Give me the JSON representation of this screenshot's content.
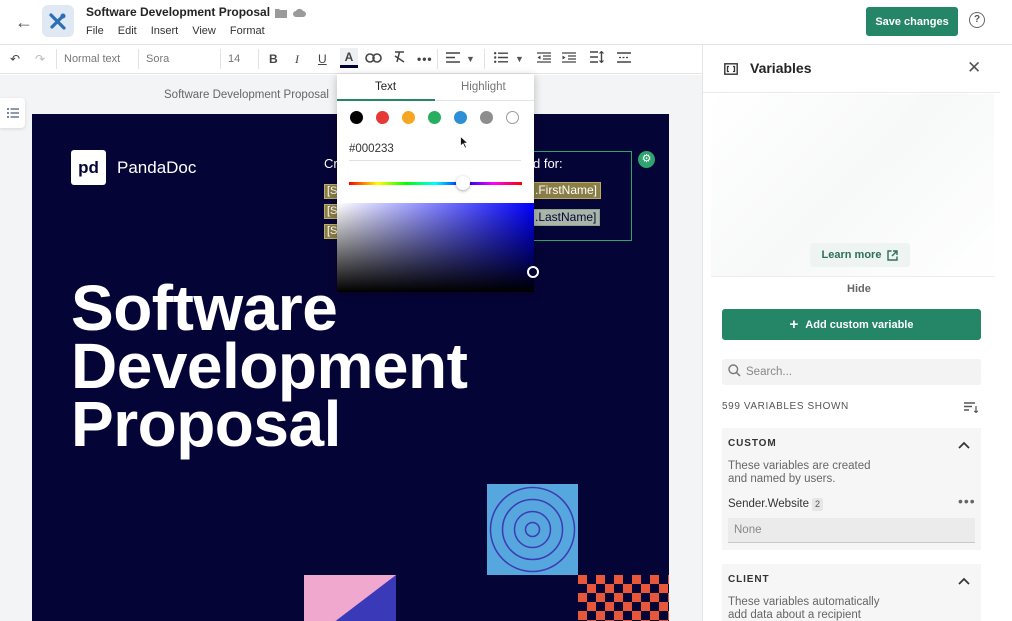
{
  "header": {
    "title": "Software Development Proposal",
    "menu": [
      "File",
      "Edit",
      "Insert",
      "View",
      "Format"
    ],
    "save_label": "Save changes",
    "help_glyph": "?"
  },
  "toolbar": {
    "style": "Normal text",
    "font": "Sora",
    "size": "14"
  },
  "document": {
    "page_label": "Software Development Proposal",
    "brand": "PandaDoc",
    "created_prefix": "Cr",
    "chip_fragment": "[S",
    "prepared_for": "d for:",
    "chip_first": ".FirstName]",
    "chip_last": ".LastName]",
    "title_lines": [
      "Software",
      "Development",
      "Proposal"
    ]
  },
  "color_picker": {
    "tabs": [
      "Text",
      "Highlight"
    ],
    "active_tab": "Text",
    "hex_value": "#000233",
    "swatches": [
      "#000000",
      "#e53935",
      "#f5a623",
      "#27ae60",
      "#2d8fd5",
      "#8e8e8e",
      "#ffffff"
    ]
  },
  "panel": {
    "title": "Variables",
    "learn_more": "Learn more",
    "hide": "Hide",
    "add_variable": "Add custom variable",
    "search_placeholder": "Search...",
    "count_label": "599 VARIABLES SHOWN",
    "sections": [
      {
        "title": "CUSTOM",
        "description": "These variables are created and named by users.",
        "variable": {
          "name": "Sender.Website",
          "badge": "2",
          "placeholder": "None"
        }
      },
      {
        "title": "CLIENT",
        "description": "These variables automatically add data about a recipient"
      }
    ]
  },
  "colors": {
    "accent": "#248567",
    "page_bg": "#050436",
    "selection": "#2ea36e"
  }
}
